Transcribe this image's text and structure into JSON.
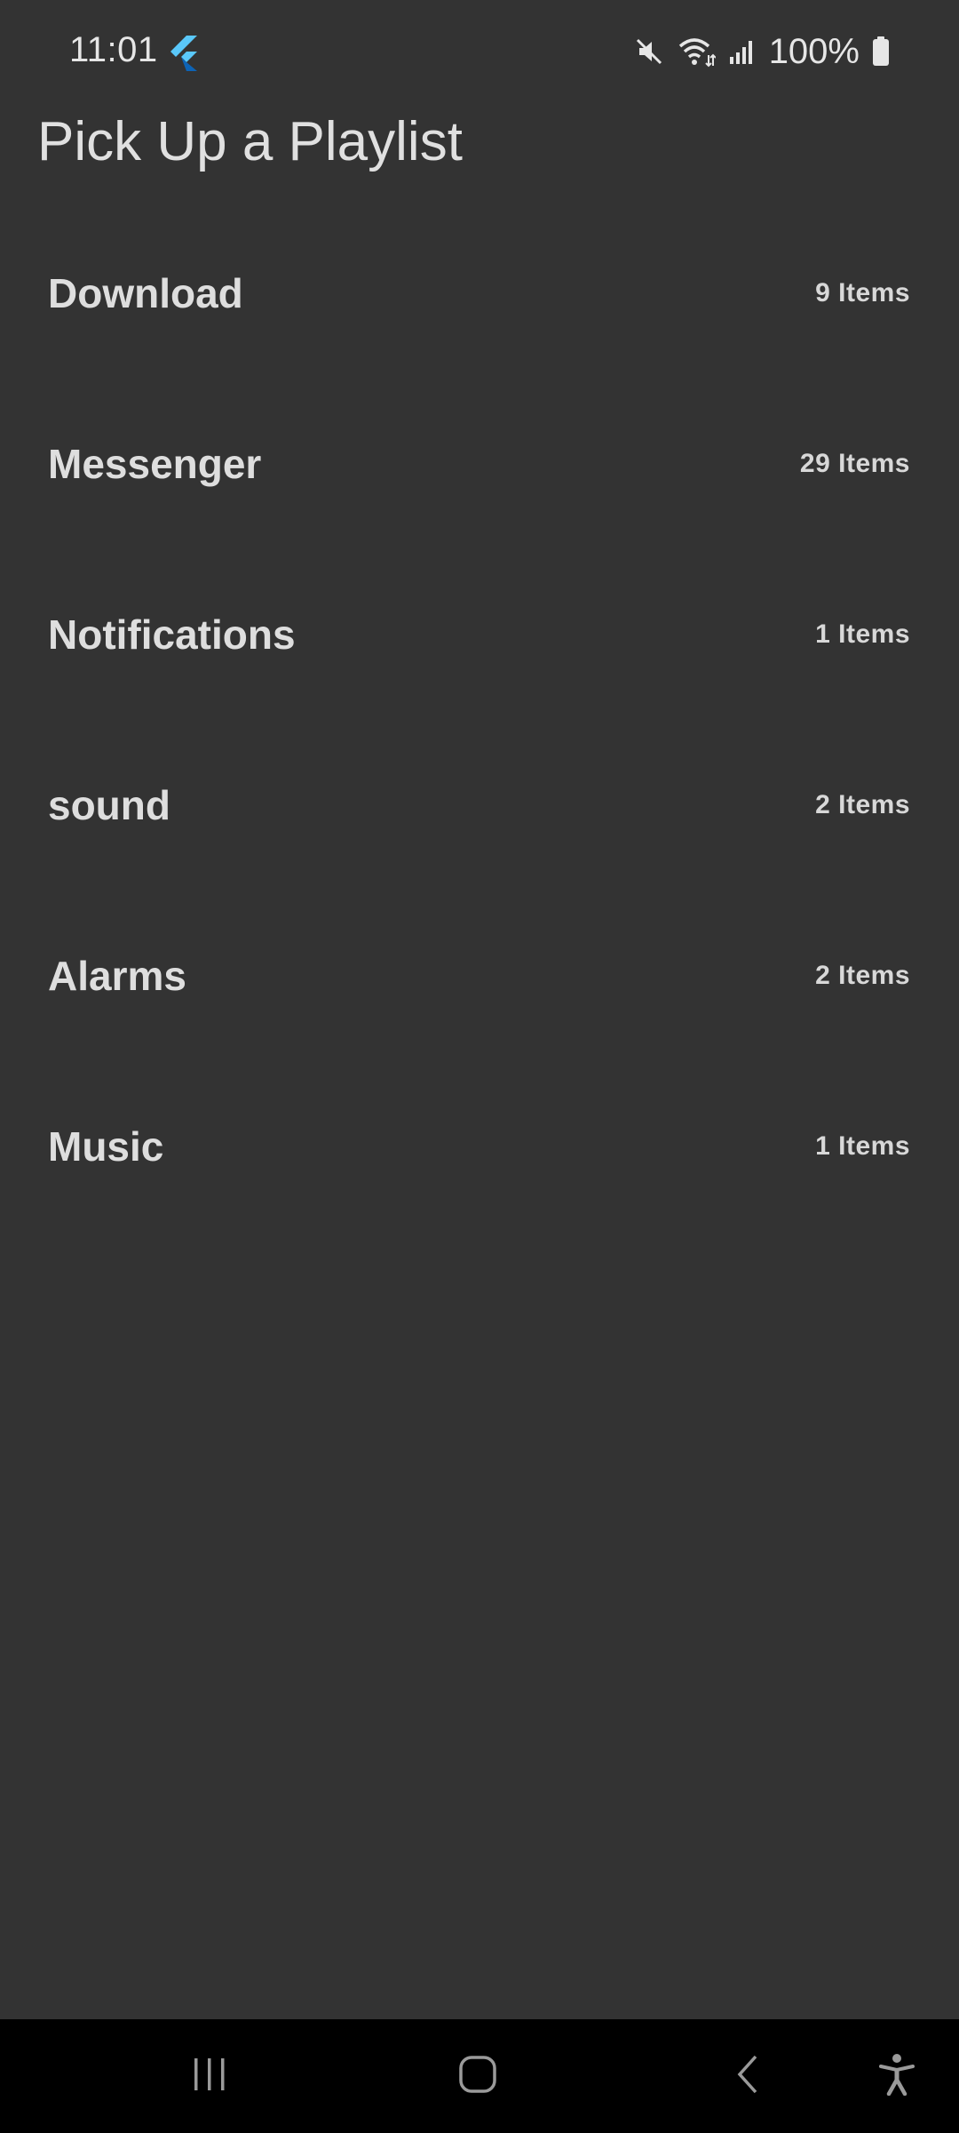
{
  "status_bar": {
    "time": "11:01",
    "battery": "100%",
    "icons": [
      "flutter-icon",
      "mute-icon",
      "wifi-icon",
      "signal-icon",
      "battery-icon"
    ]
  },
  "header": {
    "title": "Pick Up a Playlist"
  },
  "playlists": [
    {
      "name": "Download",
      "count": "9 Items"
    },
    {
      "name": "Messenger",
      "count": "29 Items"
    },
    {
      "name": "Notifications",
      "count": "1 Items"
    },
    {
      "name": "sound",
      "count": "2 Items"
    },
    {
      "name": "Alarms",
      "count": "2 Items"
    },
    {
      "name": "Music",
      "count": "1 Items"
    }
  ],
  "nav_bar": {
    "buttons": [
      "recents-icon",
      "home-icon",
      "back-icon",
      "accessibility-icon"
    ]
  },
  "colors": {
    "background": "#333333",
    "text": "#dedede",
    "nav_background": "#000000",
    "flutter_blue": "#42a5f5"
  }
}
